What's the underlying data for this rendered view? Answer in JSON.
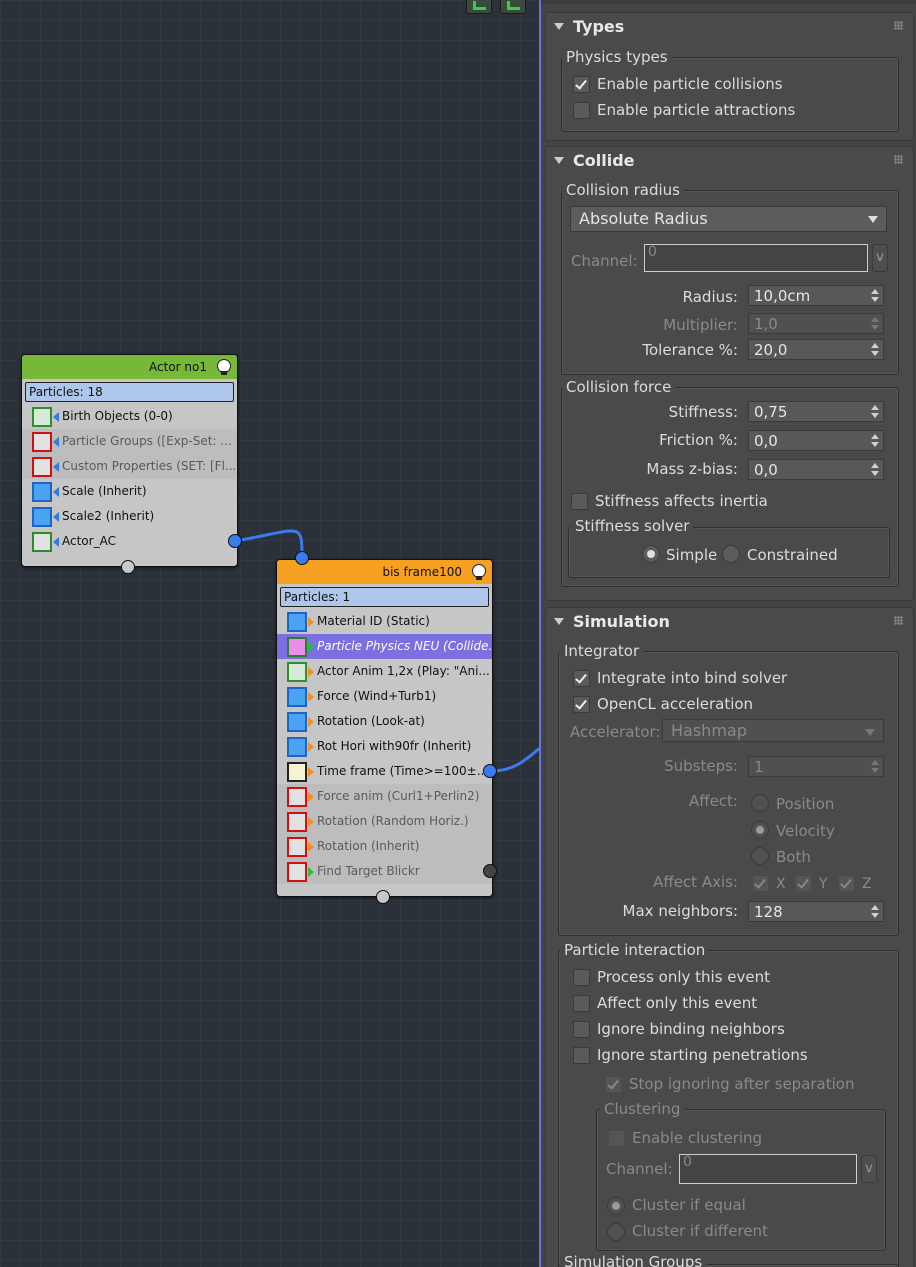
{
  "graph": {
    "node1": {
      "title": "Actor no1",
      "header_color": "#78b838",
      "particles": "Particles: 18",
      "ops": [
        {
          "name": "birth-objects-op",
          "label": "Birth Objects (0-0)",
          "icon": "birth-icon",
          "state": "normal"
        },
        {
          "name": "particle-groups-op",
          "label": "Particle Groups ([Exp-Set: ...",
          "icon": "particle-groups-icon",
          "state": "disabled"
        },
        {
          "name": "custom-properties-op",
          "label": "Custom Properties (SET: [Fl...",
          "icon": "custom-properties-icon",
          "state": "disabled"
        },
        {
          "name": "scale-op",
          "label": "Scale (Inherit)",
          "icon": "scale-icon",
          "state": "normal"
        },
        {
          "name": "scale2-op",
          "label": "Scale2 (Inherit)",
          "icon": "scale-icon",
          "state": "normal"
        },
        {
          "name": "actor-ac-op",
          "label": "Actor_AC",
          "icon": "actor-icon",
          "state": "normal"
        }
      ]
    },
    "node2": {
      "title": "bis frame100",
      "header_color": "#f5a020",
      "particles": "Particles: 1",
      "ops": [
        {
          "name": "material-id-op",
          "label": "Material ID (Static)",
          "icon": "material-icon",
          "state": "normal"
        },
        {
          "name": "particle-physics-op",
          "label": "Particle Physics NEU (Collide...",
          "icon": "physics-icon",
          "state": "selected"
        },
        {
          "name": "actor-anim-op",
          "label": "Actor Anim 1,2x (Play: \"Ani...",
          "icon": "film-icon",
          "state": "normal"
        },
        {
          "name": "force-op",
          "label": "Force (Wind+Turb1)",
          "icon": "force-icon",
          "state": "normal"
        },
        {
          "name": "rotation-lookat-op",
          "label": "Rotation (Look-at)",
          "icon": "rotation-icon",
          "state": "normal"
        },
        {
          "name": "rot-hori-op",
          "label": "Rot Hori with90fr (Inherit)",
          "icon": "rotation-icon",
          "state": "normal"
        },
        {
          "name": "time-frame-op",
          "label": "Time frame (Time>=100±...",
          "icon": "clock-icon",
          "state": "normal"
        },
        {
          "name": "force-anim-op",
          "label": "Force anim (Curl1+Perlin2)",
          "icon": "force-icon",
          "state": "disabled"
        },
        {
          "name": "rotation-random-op",
          "label": "Rotation (Random Horiz.)",
          "icon": "rotation-icon",
          "state": "disabled"
        },
        {
          "name": "rotation-inherit-op",
          "label": "Rotation (Inherit)",
          "icon": "rotation-icon",
          "state": "disabled"
        },
        {
          "name": "find-target-op",
          "label": "Find Target Blickr",
          "icon": "find-target-icon",
          "state": "disabled"
        }
      ]
    }
  },
  "panel": {
    "types": {
      "title": "Types",
      "group": "Physics types",
      "collisions": "Enable particle collisions",
      "attractions": "Enable particle attractions"
    },
    "collide": {
      "title": "Collide",
      "radius_group": "Collision radius",
      "radius_mode": "Absolute Radius",
      "channel_label": "Channel:",
      "channel_value": "0",
      "v_btn": "v",
      "radius_label": "Radius:",
      "radius_value": "10,0cm",
      "multiplier_label": "Multiplier:",
      "multiplier_value": "1,0",
      "tolerance_label": "Tolerance %:",
      "tolerance_value": "20,0",
      "force_group": "Collision force",
      "stiffness_label": "Stiffness:",
      "stiffness_value": "0,75",
      "friction_label": "Friction %:",
      "friction_value": "0,0",
      "mass_label": "Mass z-bias:",
      "mass_value": "0,0",
      "stiff_inertia": "Stiffness affects inertia",
      "solver_group": "Stiffness solver",
      "simple": "Simple",
      "constrained": "Constrained"
    },
    "simulation": {
      "title": "Simulation",
      "integrator_group": "Integrator",
      "bind_solver": "Integrate into bind solver",
      "opencl": "OpenCL acceleration",
      "accel_label": "Accelerator:",
      "accel_value": "Hashmap",
      "substeps_label": "Substeps:",
      "substeps_value": "1",
      "affect_label": "Affect:",
      "affect_position": "Position",
      "affect_velocity": "Velocity",
      "affect_both": "Both",
      "axis_label": "Affect Axis:",
      "axis_x": "X",
      "axis_y": "Y",
      "axis_z": "Z",
      "maxn_label": "Max neighbors:",
      "maxn_value": "128",
      "interaction_group": "Particle interaction",
      "process_only": "Process only this event",
      "affect_only": "Affect only this event",
      "ignore_binding": "Ignore binding neighbors",
      "ignore_start": "Ignore starting penetrations",
      "stop_ignoring": "Stop ignoring after separation",
      "clustering_group": "Clustering",
      "enable_clustering": "Enable clustering",
      "channel_label": "Channel:",
      "channel_value": "0",
      "v_btn": "v",
      "cluster_equal": "Cluster if equal",
      "cluster_different": "Cluster if different",
      "sim_groups": "Simulation Groups"
    }
  }
}
